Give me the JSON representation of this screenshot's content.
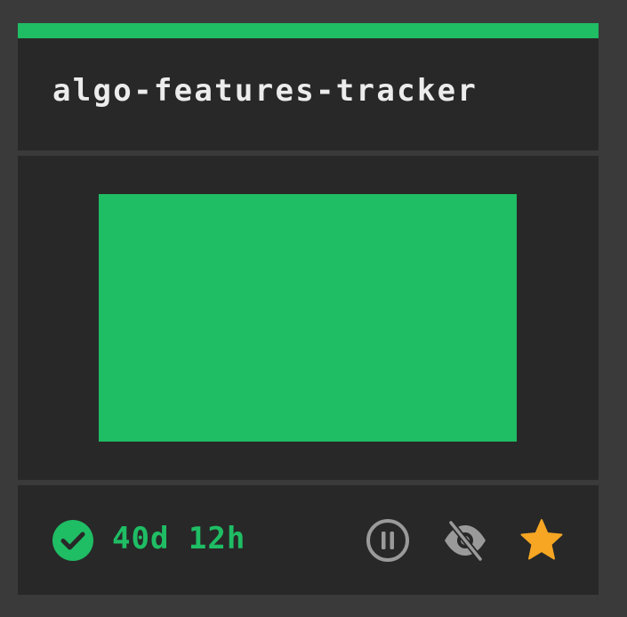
{
  "card": {
    "title": "algo-features-tracker",
    "status": "success",
    "uptime": "40d 12h"
  },
  "icons": {
    "status": "check-circle-icon",
    "pause": "pause-circle-icon",
    "hide": "eye-off-icon",
    "favorite": "star-icon"
  },
  "colors": {
    "accent": "#1fbd64",
    "background": "#3a3a3a",
    "panel": "#282828",
    "title_text": "#ececec",
    "icon_muted": "#9a9a9a",
    "star": "#f6a623"
  }
}
